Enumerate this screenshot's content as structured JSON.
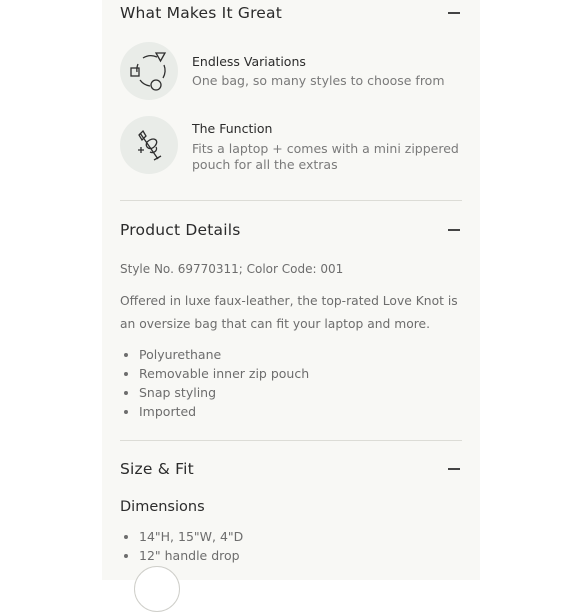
{
  "great": {
    "title": "What Makes It Great",
    "features": [
      {
        "icon": "cycle-shapes-icon",
        "title": "Endless Variations",
        "desc": "One bag, so many styles to choose from"
      },
      {
        "icon": "laptop-bag-icon",
        "title": "The Function",
        "desc": "Fits a laptop + comes with a mini zippered pouch for all the extras"
      }
    ]
  },
  "details": {
    "title": "Product Details",
    "style_line": "Style No. 69770311; Color Code: 001",
    "description": "Offered in luxe faux-leather, the top-rated Love Knot is an oversize bag that can fit your laptop and more.",
    "bullets": [
      "Polyurethane",
      "Removable inner zip pouch",
      "Snap styling",
      "Imported"
    ]
  },
  "size_fit": {
    "title": "Size & Fit",
    "dimensions_title": "Dimensions",
    "bullets": [
      "14\"H, 15\"W, 4\"D",
      "12\" handle drop"
    ]
  }
}
